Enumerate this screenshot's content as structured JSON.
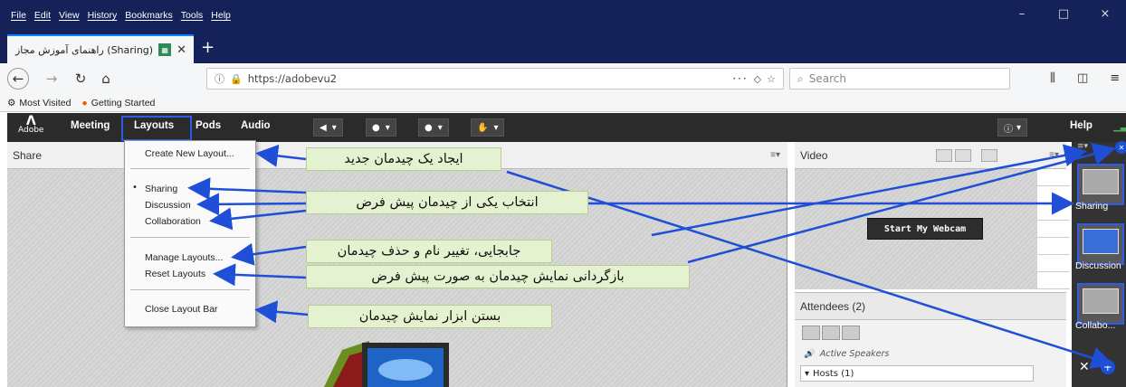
{
  "browser": {
    "menu": [
      "File",
      "Edit",
      "View",
      "History",
      "Bookmarks",
      "Tools",
      "Help"
    ],
    "window_controls": [
      "–",
      "□",
      "×"
    ],
    "tab": {
      "title": "(Sharing) راهنمای آموزش مجازی"
    },
    "url": "https://adobevu2",
    "search_placeholder": "Search",
    "bookmarks": [
      "Most Visited",
      "Getting Started"
    ]
  },
  "app": {
    "logo_text": "Adobe",
    "menus": [
      "Meeting",
      "Layouts",
      "Pods",
      "Audio"
    ],
    "help_label": "Help"
  },
  "layouts_menu": {
    "items": {
      "create": "Create New Layout...",
      "sharing": "Sharing",
      "discussion": "Discussion",
      "collaboration": "Collaboration",
      "manage": "Manage Layouts...",
      "reset": "Reset Layouts",
      "close": "Close Layout Bar"
    }
  },
  "pods": {
    "share_title": "Share",
    "video_title": "Video",
    "webcam_button": "Start My Webcam",
    "attendees_title": "Attendees",
    "attendees_count": "(2)",
    "active_speakers": "Active Speakers",
    "hosts": "Hosts (1)"
  },
  "layout_bar": {
    "items": [
      "Sharing",
      "Discussion",
      "Collabo..."
    ]
  },
  "annotations": {
    "create": "ایجاد یک چیدمان جدید",
    "select_default": "انتخاب یکی از چیدمان پیش فرض",
    "manage": "جابجایی، تغییر نام و حذف چیدمان",
    "reset": "بازگردانی نمایش چیدمان به صورت پیش فرض",
    "close": "بستن ابزار نمایش چیدمان"
  },
  "colors": {
    "firefox_dark": "#15225a",
    "adobe_bar": "#2b2b2b",
    "highlight": "#2f5bea",
    "callout_bg": "#e5f2cf"
  }
}
